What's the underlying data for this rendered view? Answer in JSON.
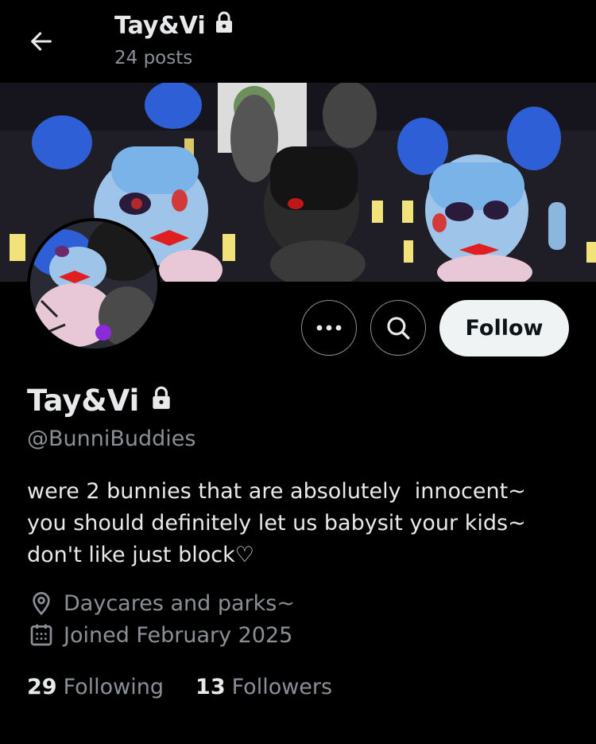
{
  "header": {
    "title": "Tay&Vi",
    "posts_count": "24 posts"
  },
  "actions": {
    "follow_label": "Follow"
  },
  "profile": {
    "display_name": "Tay&Vi",
    "handle": "@BunniBuddies",
    "bio": "were 2 bunnies that are absolutely  innocent~\nyou should definitely let us babysit your kids~\ndon't like just block♡",
    "location": "Daycares and parks~",
    "joined": "Joined February 2025"
  },
  "stats": {
    "following_count": "29",
    "following_label": "Following",
    "followers_count": "13",
    "followers_label": "Followers"
  },
  "colors": {
    "background": "#000000",
    "text_primary": "#e7e9ea",
    "text_secondary": "#8b9096",
    "follow_bg": "#eff3f4"
  },
  "icons": [
    "back-arrow-icon",
    "lock-icon",
    "more-icon",
    "search-icon",
    "location-pin-icon",
    "calendar-icon"
  ]
}
